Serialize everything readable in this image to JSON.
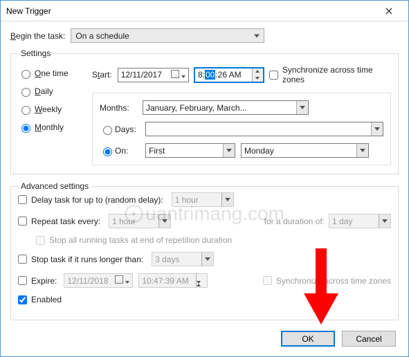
{
  "title": "New Trigger",
  "begin_label": "Begin the task:",
  "begin_value": "On a schedule",
  "settings_legend": "Settings",
  "schedule": {
    "onetime": "One time",
    "daily": "Daily",
    "weekly": "Weekly",
    "monthly": "Monthly",
    "selected": "monthly"
  },
  "start": {
    "label": "Start:",
    "date": "12/11/2017",
    "time_prefix": "8:",
    "time_sel": "00",
    "time_suffix": ":26 AM",
    "sync_label": "Synchronize across time zones"
  },
  "monthly": {
    "months_label": "Months:",
    "months_value": "January, February, March...",
    "days_label": "Days:",
    "on_label": "On:",
    "on_ord": "First",
    "on_day": "Monday"
  },
  "adv": {
    "legend": "Advanced settings",
    "delay_label": "Delay task for up to (random delay):",
    "delay_value": "1 hour",
    "repeat_label": "Repeat task every:",
    "repeat_value": "1 hour",
    "duration_label": "for a duration of:",
    "duration_value": "1 day",
    "stop_end_label": "Stop all running tasks at end of repetition duration",
    "stop_long_label": "Stop task if it runs longer than:",
    "stop_long_value": "3 days",
    "expire_label": "Expire:",
    "expire_date": "12/11/2018",
    "expire_time": "10:47:39 AM",
    "expire_sync": "Synchronize across time zones",
    "enabled_label": "Enabled"
  },
  "buttons": {
    "ok": "OK",
    "cancel": "Cancel"
  },
  "watermark": "uantrimang.com"
}
